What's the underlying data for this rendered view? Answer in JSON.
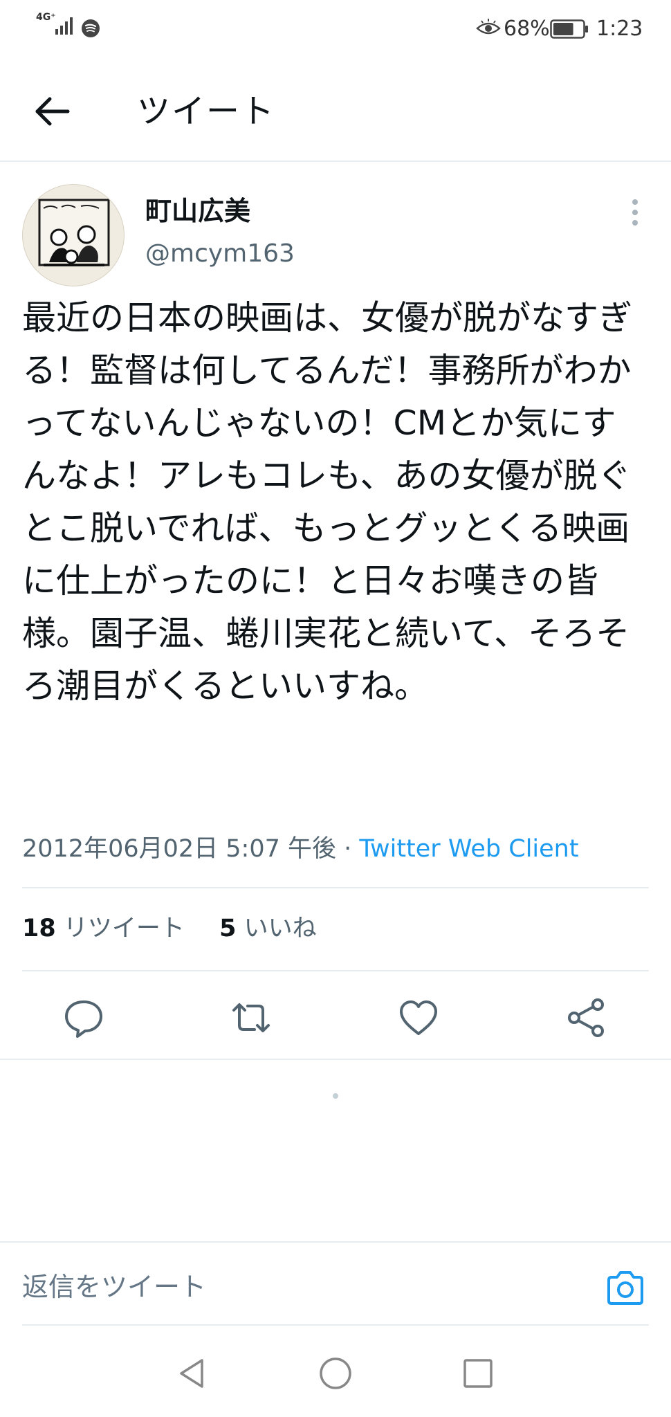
{
  "status_bar": {
    "network": "4G⁺",
    "battery_percent": "68%",
    "battery_level": 0.68,
    "time": "1:23"
  },
  "header": {
    "title": "ツイート"
  },
  "tweet": {
    "author_name": "町山広美",
    "author_handle": "@mcym163",
    "text": "最近の日本の映画は、女優が脱がなすぎる！監督は何してるんだ！事務所がわかってないんじゃないの！CMとか気にすんなよ！アレもコレも、あの女優が脱ぐとこ脱いでれば、もっとグッとくる映画に仕上がったのに！と日々お嘆きの皆様。園子温、蜷川実花と続いて、そろそろ潮目がくるといいすね。",
    "timestamp": "2012年06月02日 5:07 午後",
    "separator": " · ",
    "client": "Twitter Web Client",
    "retweet_count": "18",
    "retweet_label": "リツイート",
    "like_count": "5",
    "like_label": "いいね"
  },
  "reply": {
    "placeholder": "返信をツイート"
  },
  "icons": {
    "back": "arrow-left-icon",
    "more": "more-vertical-icon",
    "reply": "reply-icon",
    "retweet": "retweet-icon",
    "like": "heart-icon",
    "share": "share-icon",
    "camera": "camera-icon"
  },
  "colors": {
    "accent": "#1d9bf0",
    "text": "#0f1419",
    "secondary": "#536471",
    "divider": "#e6ecf0"
  }
}
